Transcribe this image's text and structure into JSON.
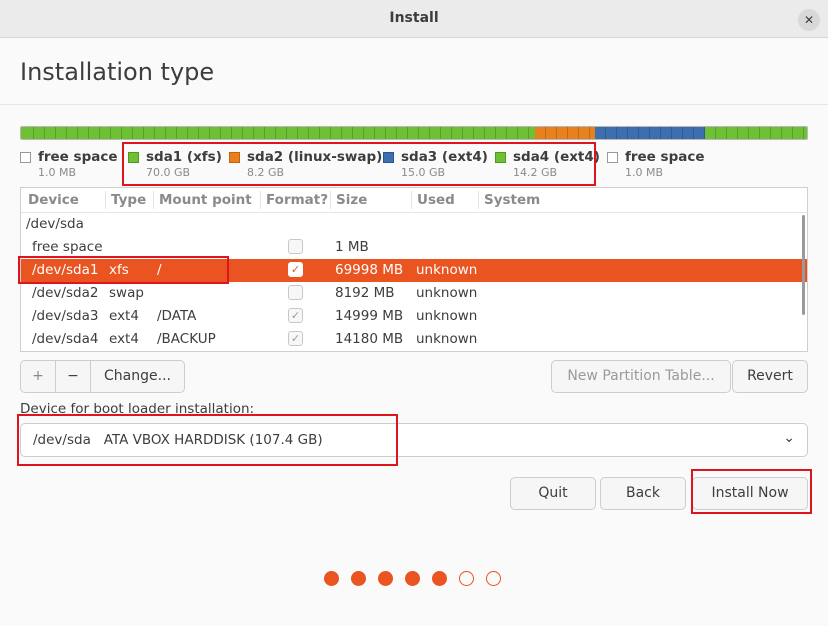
{
  "window": {
    "title": "Install",
    "close_glyph": "✕"
  },
  "page": {
    "heading": "Installation type"
  },
  "colors": {
    "accent": "#e95420",
    "free": "#ffffff",
    "sda1": "#6ec034",
    "sda2": "#e8801e",
    "sda3": "#3d6fb0",
    "sda4": "#6ec034"
  },
  "partition_bar": [
    {
      "name": "free space",
      "fraction": 1e-05
    },
    {
      "name": "sda1 (xfs)",
      "fraction": 0.652
    },
    {
      "name": "sda2 (linux-swap)",
      "fraction": 0.076
    },
    {
      "name": "sda3 (ext4)",
      "fraction": 0.14
    },
    {
      "name": "sda4 (ext4)",
      "fraction": 0.132
    },
    {
      "name": "free space",
      "fraction": 1e-05
    }
  ],
  "legend": [
    {
      "name": "free space",
      "size": "1.0 MB"
    },
    {
      "name": "sda1 (xfs)",
      "size": "70.0 GB"
    },
    {
      "name": "sda2 (linux-swap)",
      "size": "8.2 GB"
    },
    {
      "name": "sda3 (ext4)",
      "size": "15.0 GB"
    },
    {
      "name": "sda4 (ext4)",
      "size": "14.2 GB"
    },
    {
      "name": "free space",
      "size": "1.0 MB"
    }
  ],
  "table": {
    "headers": [
      "Device",
      "Type",
      "Mount point",
      "Format?",
      "Size",
      "Used",
      "System"
    ],
    "rows": [
      {
        "device": "/dev/sda",
        "type": "",
        "mount": "",
        "format": "",
        "size": "",
        "used": "",
        "system": ""
      },
      {
        "device": "free space",
        "type": "",
        "mount": "",
        "format": "unchecked",
        "size": "1 MB",
        "used": "",
        "system": ""
      },
      {
        "device": "/dev/sda1",
        "type": "xfs",
        "mount": "/",
        "format": "checked",
        "size": "69998 MB",
        "used": "unknown",
        "system": ""
      },
      {
        "device": "/dev/sda2",
        "type": "swap",
        "mount": "",
        "format": "unchecked",
        "size": "8192 MB",
        "used": "unknown",
        "system": ""
      },
      {
        "device": "/dev/sda3",
        "type": "ext4",
        "mount": "/DATA",
        "format": "checked",
        "size": "14999 MB",
        "used": "unknown",
        "system": ""
      },
      {
        "device": "/dev/sda4",
        "type": "ext4",
        "mount": "/BACKUP",
        "format": "checked",
        "size": "14180 MB",
        "used": "unknown",
        "system": ""
      }
    ],
    "selected_row": 2
  },
  "toolbar": {
    "add": "+",
    "remove": "−",
    "change": "Change...",
    "new_table": "New Partition Table...",
    "revert": "Revert"
  },
  "bootloader": {
    "label": "Device for boot loader installation:",
    "value": "/dev/sda   ATA VBOX HARDDISK (107.4 GB)",
    "chevron": "⌄"
  },
  "actions": {
    "quit": "Quit",
    "back": "Back",
    "install": "Install Now"
  },
  "progress": {
    "total_steps": 7,
    "completed_steps": 5
  }
}
